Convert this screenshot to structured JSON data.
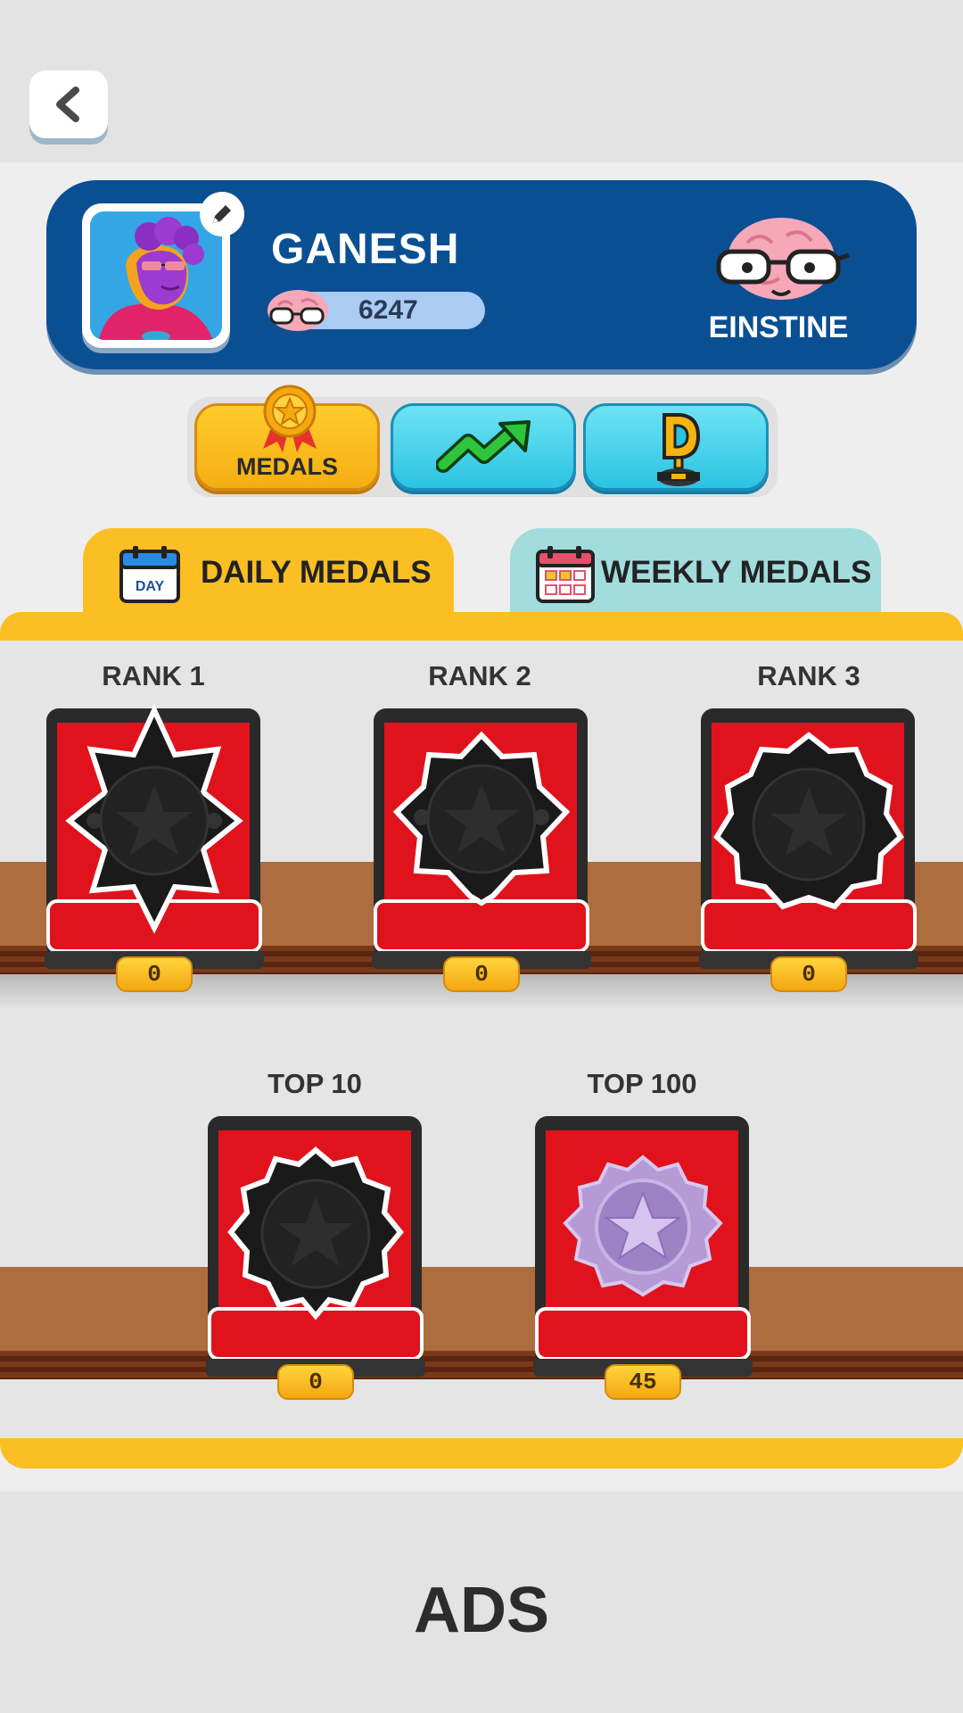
{
  "header": {
    "back_label": "back"
  },
  "profile": {
    "name": "GANESH",
    "score": "6247",
    "rank_title": "EINSTINE"
  },
  "modes": [
    {
      "label": "MEDALS",
      "icon": "medal-icon",
      "selected": true
    },
    {
      "label": "",
      "icon": "trend-up-icon",
      "selected": false
    },
    {
      "label": "",
      "icon": "trophy-icon",
      "selected": false
    }
  ],
  "tabs": {
    "daily": {
      "label": "DAILY MEDALS",
      "icon_text": "DAY",
      "active": true
    },
    "weekly": {
      "label": "WEEKLY MEDALS",
      "active": false
    }
  },
  "medals": {
    "rank1": {
      "label": "RANK 1",
      "count": "0"
    },
    "rank2": {
      "label": "RANK 2",
      "count": "0"
    },
    "rank3": {
      "label": "RANK 3",
      "count": "0"
    },
    "top10": {
      "label": "TOP 10",
      "count": "0"
    },
    "top100": {
      "label": "TOP 100",
      "count": "45"
    }
  },
  "ads": {
    "label": "ADS"
  },
  "colors": {
    "card_blue": "#0b4f93",
    "accent_yellow": "#fbbf24",
    "tab_teal": "#a2dcdd",
    "box_red": "#e0131d"
  }
}
